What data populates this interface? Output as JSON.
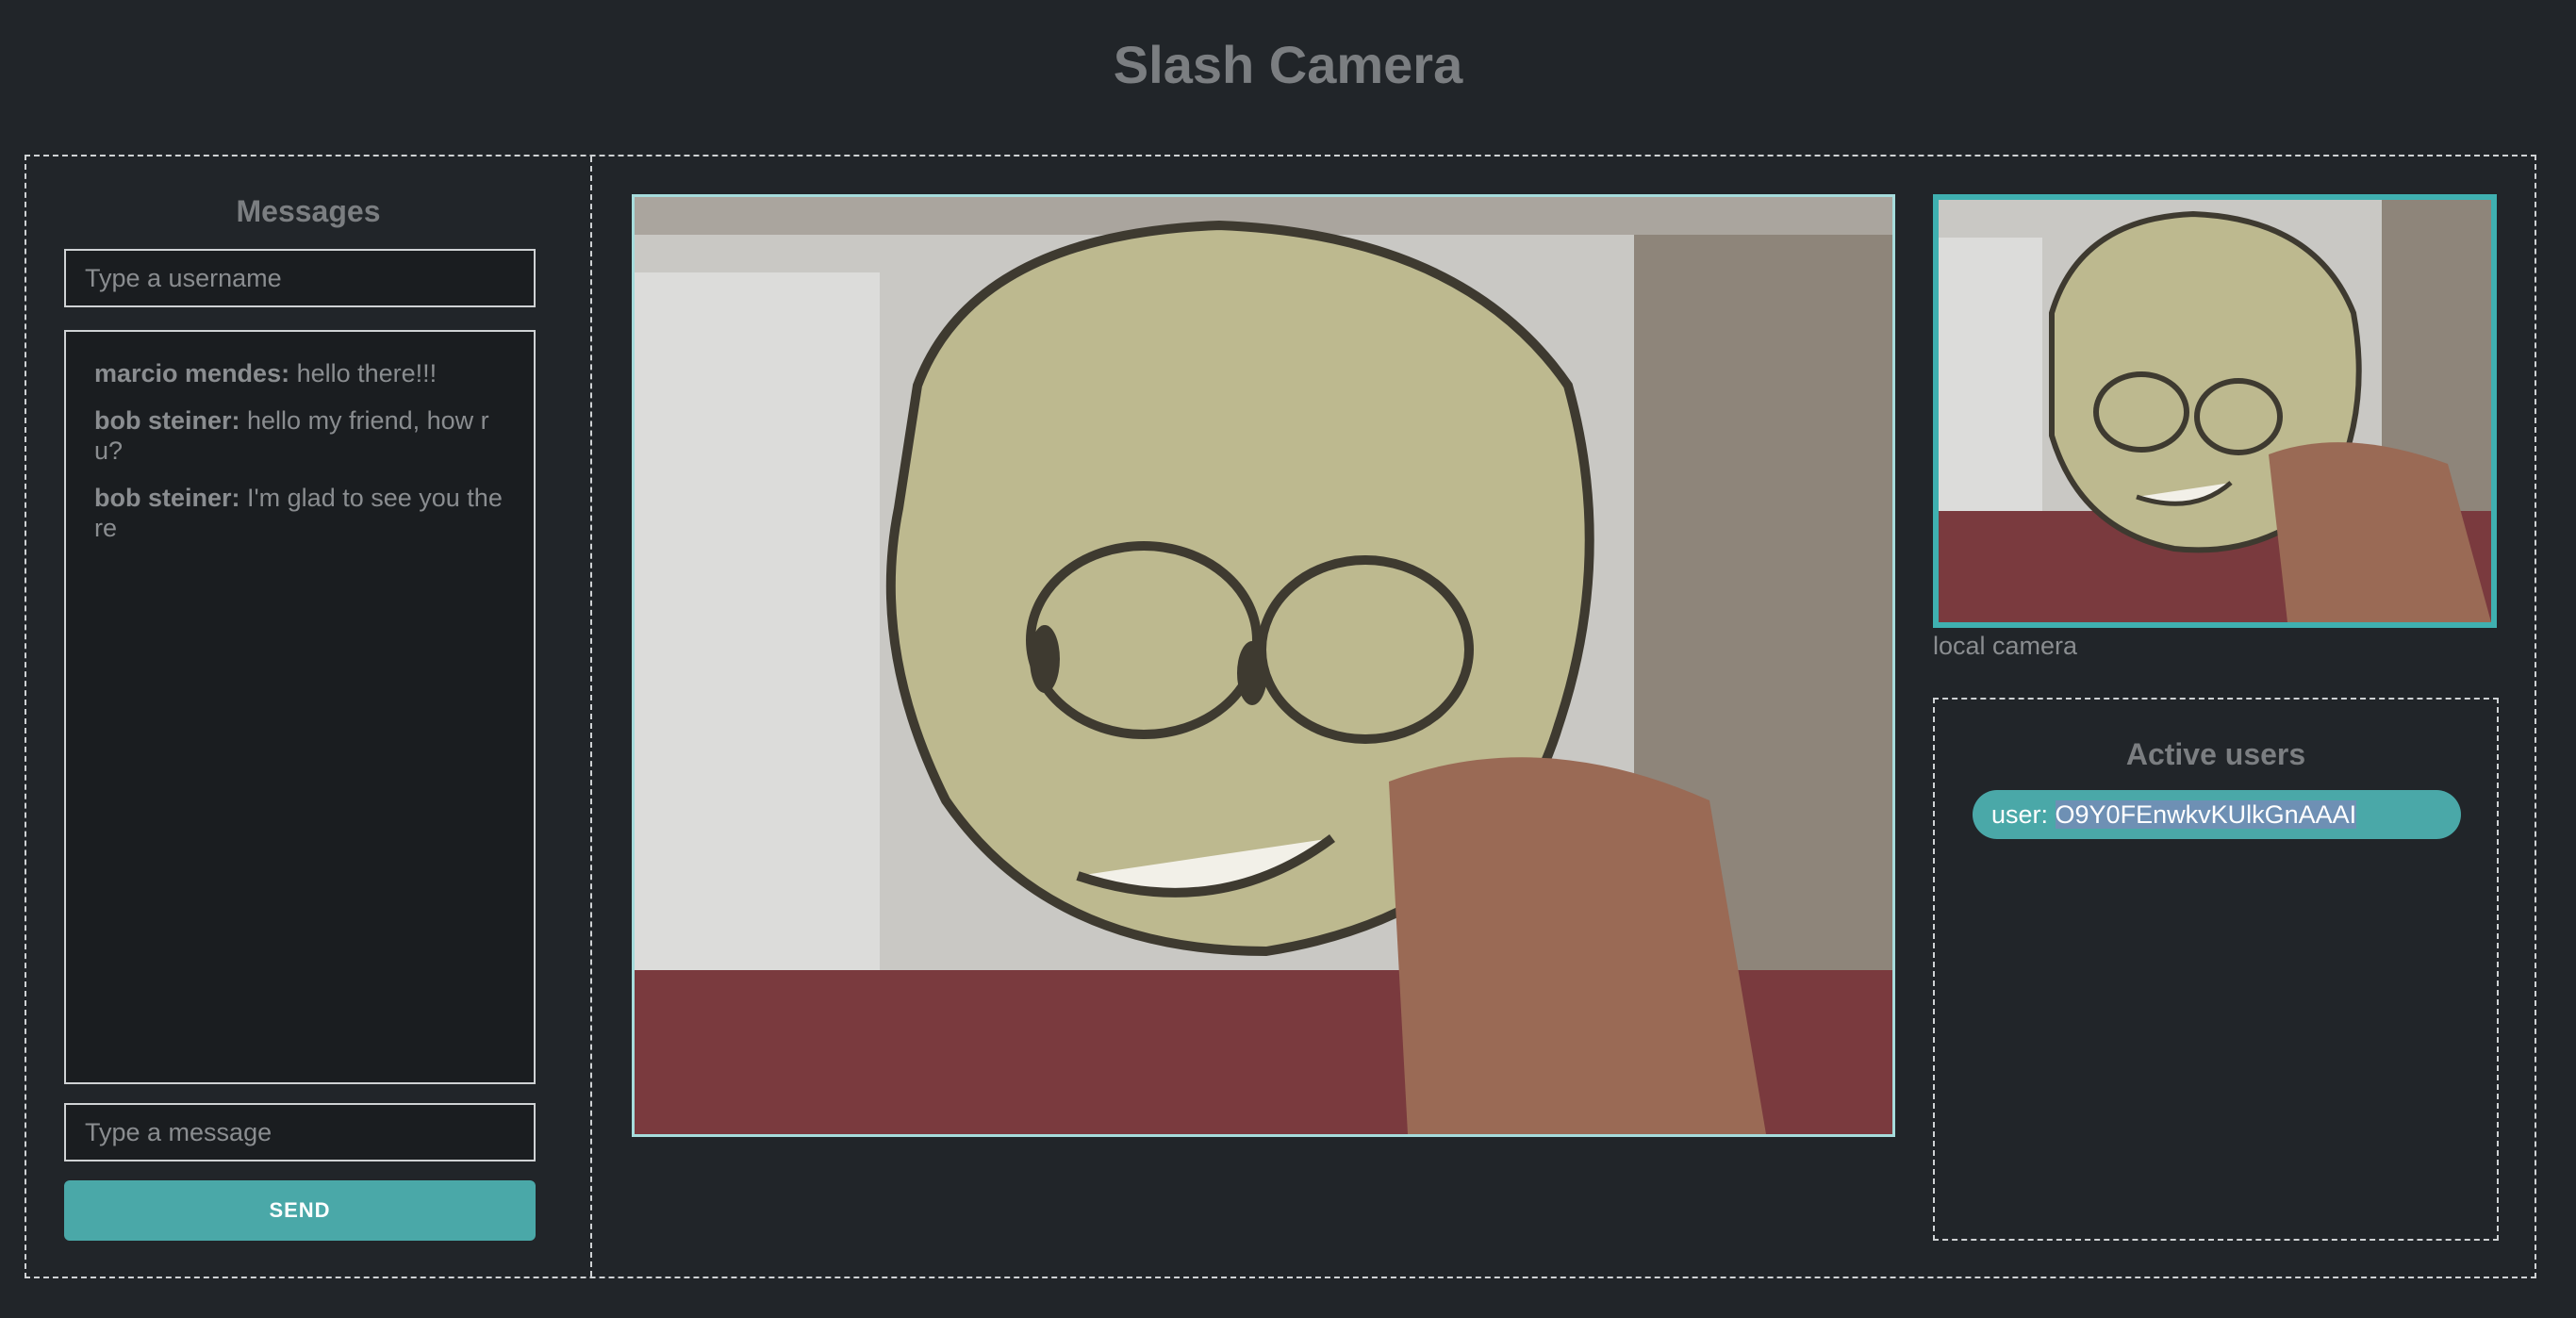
{
  "app": {
    "title": "Slash Camera"
  },
  "messages": {
    "title": "Messages",
    "username_placeholder": "Type a username",
    "message_placeholder": "Type a message",
    "send_label": "SEND",
    "items": [
      {
        "author": "marcio mendes:",
        "text": " hello there!!!"
      },
      {
        "author": "bob steiner:",
        "text": " hello my friend, how r u?"
      },
      {
        "author": "bob steiner:",
        "text": " I'm glad to see you there"
      }
    ]
  },
  "video": {
    "local_label": "local camera"
  },
  "users": {
    "title": "Active users",
    "list": [
      {
        "prefix": "user: ",
        "id": "O9Y0FEnwkvKUlkGnAAAI"
      }
    ]
  },
  "colors": {
    "background": "#212529",
    "accent": "#4aa8a8",
    "remote_video_border": "#a6dcdc",
    "local_video_border": "#3fb0b0"
  }
}
